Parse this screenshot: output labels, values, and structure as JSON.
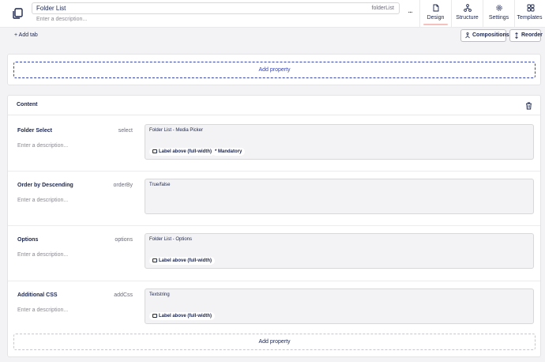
{
  "header": {
    "name": "Folder List",
    "alias": "folderList",
    "description_placeholder": "Enter a description...",
    "more_label": "...",
    "tabs": [
      {
        "label": "Design",
        "icon": "document-icon"
      },
      {
        "label": "Structure",
        "icon": "structure-icon"
      },
      {
        "label": "Settings",
        "icon": "gear-icon"
      },
      {
        "label": "Templates",
        "icon": "templates-icon"
      }
    ],
    "active_tab": "Design"
  },
  "toolbar": {
    "add_tab_label": "+ Add tab",
    "compositions_label": "Compositions",
    "reorder_label": "Reorder"
  },
  "top_group": {
    "add_property_label": "Add property"
  },
  "content_group": {
    "title": "Content",
    "properties": [
      {
        "name": "Folder Select",
        "alias": "select",
        "description_placeholder": "Enter a description...",
        "type": "Folder List - Media Picker",
        "label_chip": "Label above (full-width)",
        "mandatory_chip": "* Mandatory"
      },
      {
        "name": "Order by Descending",
        "alias": "orderBy",
        "description_placeholder": "Enter a description...",
        "type": "True/false"
      },
      {
        "name": "Options",
        "alias": "options",
        "description_placeholder": "Enter a description...",
        "type": "Folder List - Options",
        "label_chip": "Label above (full-width)"
      },
      {
        "name": "Additional CSS",
        "alias": "addCss",
        "description_placeholder": "Enter a description...",
        "type": "Textstring",
        "label_chip": "Label above (full-width)"
      }
    ],
    "add_property_label": "Add property"
  },
  "colors": {
    "accent": "#3544b1",
    "text": "#1b264f",
    "active_tab_underline": "#f5c1bc",
    "background": "#f3f3f5"
  }
}
